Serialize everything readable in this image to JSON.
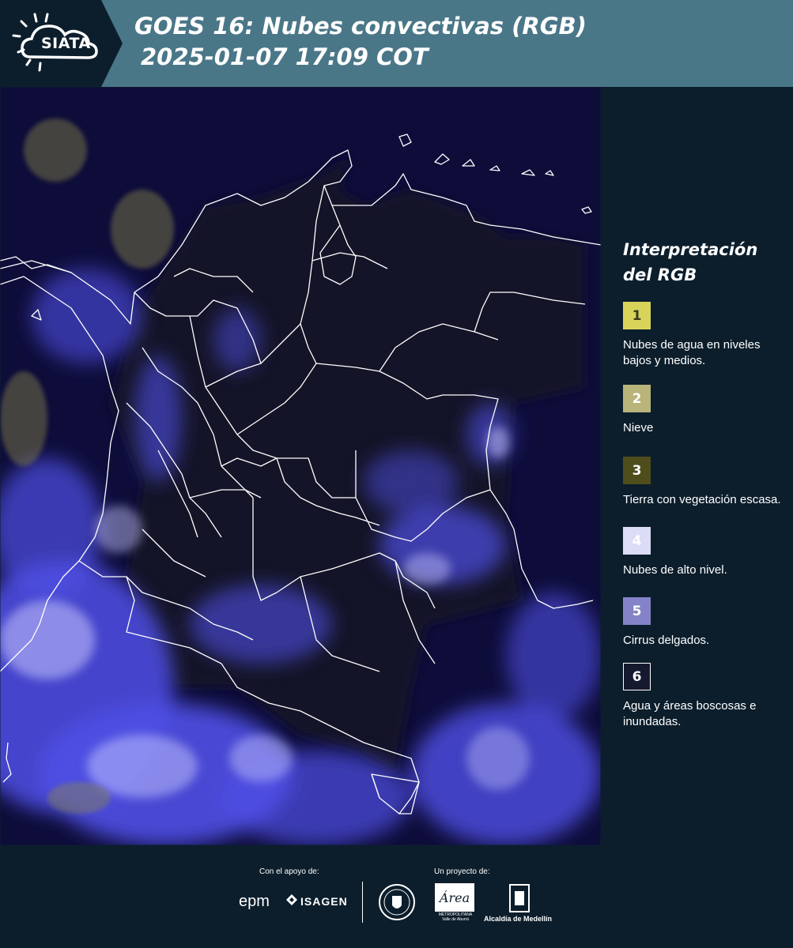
{
  "header": {
    "logo_text": "SIATA",
    "title_line1": "GOES 16: Nubes convectivas (RGB)",
    "title_line2": "2025-01-07 17:09 COT"
  },
  "map": {
    "background_color": "#0e0d3a",
    "cloud_color": "#5a5cf0",
    "border_color": "#ffffff"
  },
  "legend": {
    "title": "Interpretación\ndel RGB",
    "items": [
      {
        "number": "1",
        "color": "#d8d45a",
        "text_color": "#3a3a1e",
        "label": "Nubes de agua en niveles bajos y medios."
      },
      {
        "number": "2",
        "color": "#b9b47a",
        "text_color": "#ffffff",
        "label": "Nieve"
      },
      {
        "number": "3",
        "color": "#4f4d1c",
        "text_color": "#ffffff",
        "label": "Tierra con vegetación escasa."
      },
      {
        "number": "4",
        "color": "#dcdcf6",
        "text_color": "#ffffff",
        "label": "Nubes de alto nivel."
      },
      {
        "number": "5",
        "color": "#8483c8",
        "text_color": "#ffffff",
        "label": "Cirrus delgados."
      },
      {
        "number": "6",
        "color": "#161a30",
        "text_color": "#ffffff",
        "label": "Agua y áreas boscosas e inundadas."
      }
    ]
  },
  "footer": {
    "support_label": "Con el apoyo de:",
    "project_label": "Un proyecto de:",
    "sponsor_epm": "epm",
    "sponsor_isagen": "ISAGEN",
    "area_logo_text": "Área",
    "area_sub_text": "METROPOLITANA Valle de Aburrá",
    "alcaldia": "Alcaldía de Medellín"
  }
}
